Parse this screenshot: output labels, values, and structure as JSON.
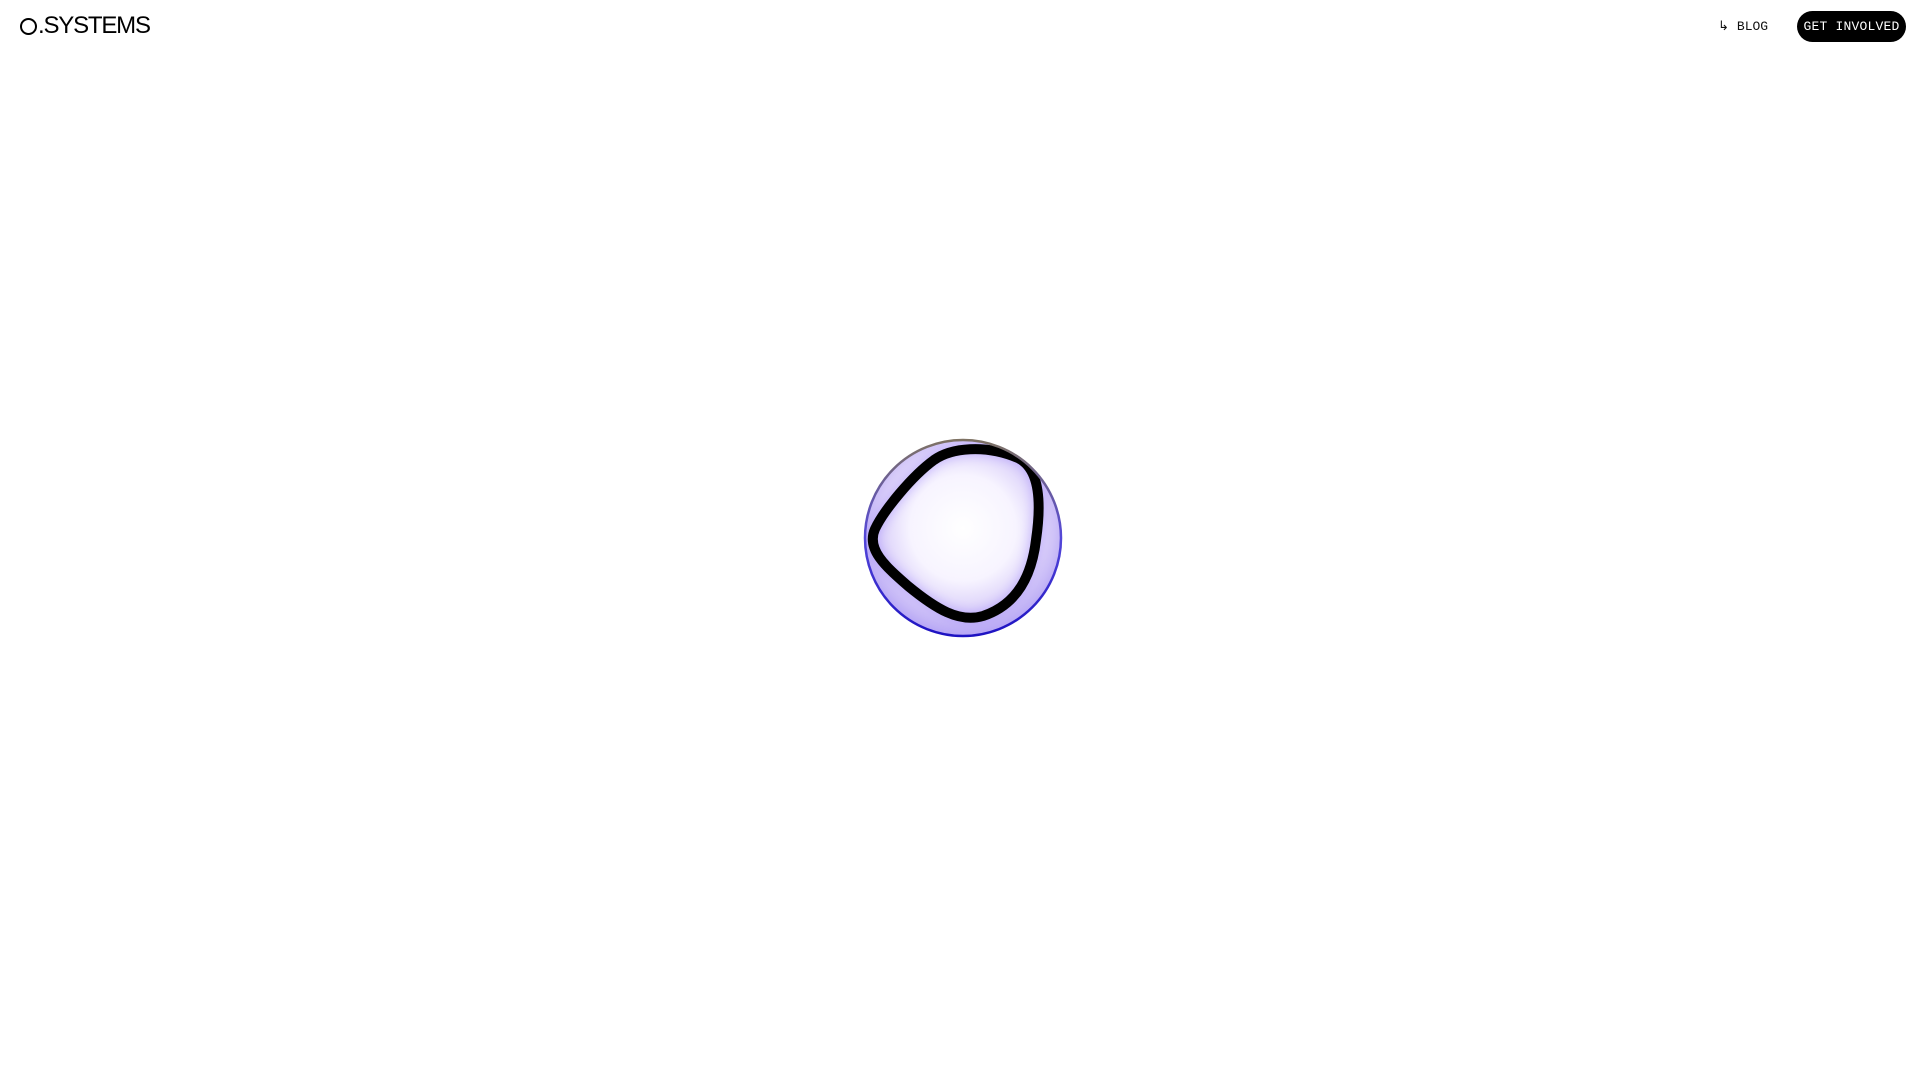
{
  "header": {
    "logo_text": ".SYSTEMS",
    "logo_mark_icon": "ring-logo-mark",
    "nav": {
      "blog_icon": "arrow-return-right-icon",
      "blog_label": "BLOG"
    },
    "cta_label": "GET INVOLVED"
  },
  "hero": {
    "graphic": "lens-orb-with-rounded-triangle-ring"
  },
  "colors": {
    "background": "#ffffff",
    "text": "#000000",
    "cta_background": "#000000",
    "cta_text": "#ffffff",
    "orb_tint": "#b8a8f5",
    "orb_rim": "#2a1fc0"
  }
}
